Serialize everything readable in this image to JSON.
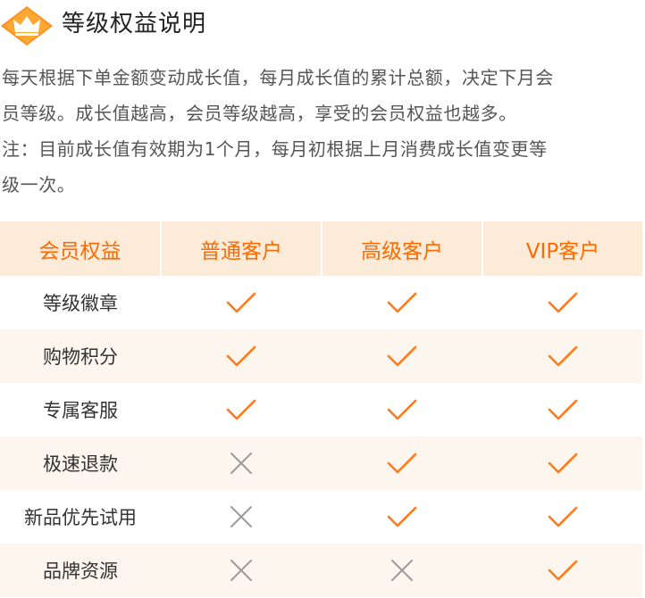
{
  "header": {
    "title": "等级权益说明",
    "icon": "crown-icon"
  },
  "description": {
    "lines": [
      "每天根据下单金额变动成长值，每月成长值的累计总额，决定下月会",
      "员等级。成长值越高，会员等级越高，享受的会员权益也越多。",
      "注：目前成长值有效期为1个月，每月初根据上月消费成长值变更等",
      "级一次。"
    ]
  },
  "table": {
    "headers": [
      "会员权益",
      "普通客户",
      "高级客户",
      "VIP客户"
    ],
    "rows": [
      {
        "benefit": "等级徽章",
        "values": [
          "check",
          "check",
          "check"
        ]
      },
      {
        "benefit": "购物积分",
        "values": [
          "check",
          "check",
          "check"
        ]
      },
      {
        "benefit": "专属客服",
        "values": [
          "check",
          "check",
          "check"
        ]
      },
      {
        "benefit": "极速退款",
        "values": [
          "cross",
          "check",
          "check"
        ]
      },
      {
        "benefit": "新品优先试用",
        "values": [
          "cross",
          "check",
          "check"
        ]
      },
      {
        "benefit": "品牌资源",
        "values": [
          "cross",
          "cross",
          "check"
        ]
      }
    ]
  },
  "colors": {
    "accent": "#ff6a00",
    "header_bg": "#fcebd9",
    "alt_row_bg": "#fdf6ee",
    "check": "#ff7a1a",
    "cross": "#9a9a9a"
  }
}
